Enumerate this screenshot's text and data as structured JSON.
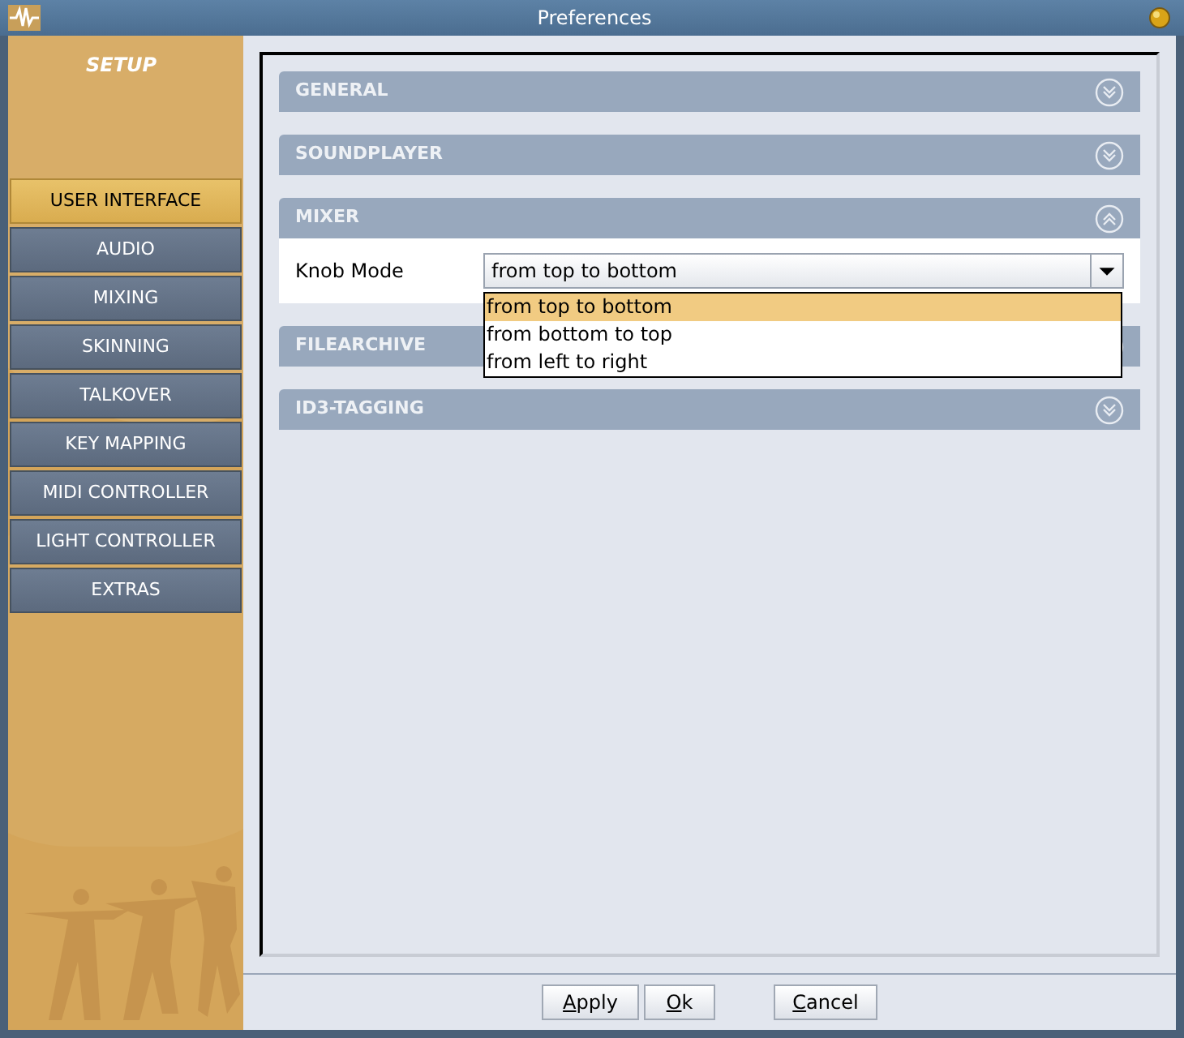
{
  "window": {
    "title": "Preferences"
  },
  "sidebar": {
    "title": "SETUP",
    "items": [
      {
        "label": "USER INTERFACE",
        "selected": true
      },
      {
        "label": "AUDIO",
        "selected": false
      },
      {
        "label": "MIXING",
        "selected": false
      },
      {
        "label": "SKINNING",
        "selected": false
      },
      {
        "label": "TALKOVER",
        "selected": false
      },
      {
        "label": "KEY MAPPING",
        "selected": false
      },
      {
        "label": "MIDI CONTROLLER",
        "selected": false
      },
      {
        "label": "LIGHT CONTROLLER",
        "selected": false
      },
      {
        "label": "EXTRAS",
        "selected": false
      }
    ]
  },
  "sections": [
    {
      "title": "GENERAL",
      "expanded": false
    },
    {
      "title": "SOUNDPLAYER",
      "expanded": false
    },
    {
      "title": "MIXER",
      "expanded": true,
      "fields": [
        {
          "label": "Knob Mode",
          "value": "from top to bottom",
          "open": true,
          "options": [
            {
              "label": "from top to bottom",
              "selected": true
            },
            {
              "label": "from bottom to top",
              "selected": false
            },
            {
              "label": "from left to right",
              "selected": false
            }
          ]
        }
      ]
    },
    {
      "title": "FILEARCHIVE",
      "expanded": false
    },
    {
      "title": "ID3-TAGGING",
      "expanded": false
    }
  ],
  "buttons": [
    "Apply",
    "Ok",
    "Cancel"
  ]
}
